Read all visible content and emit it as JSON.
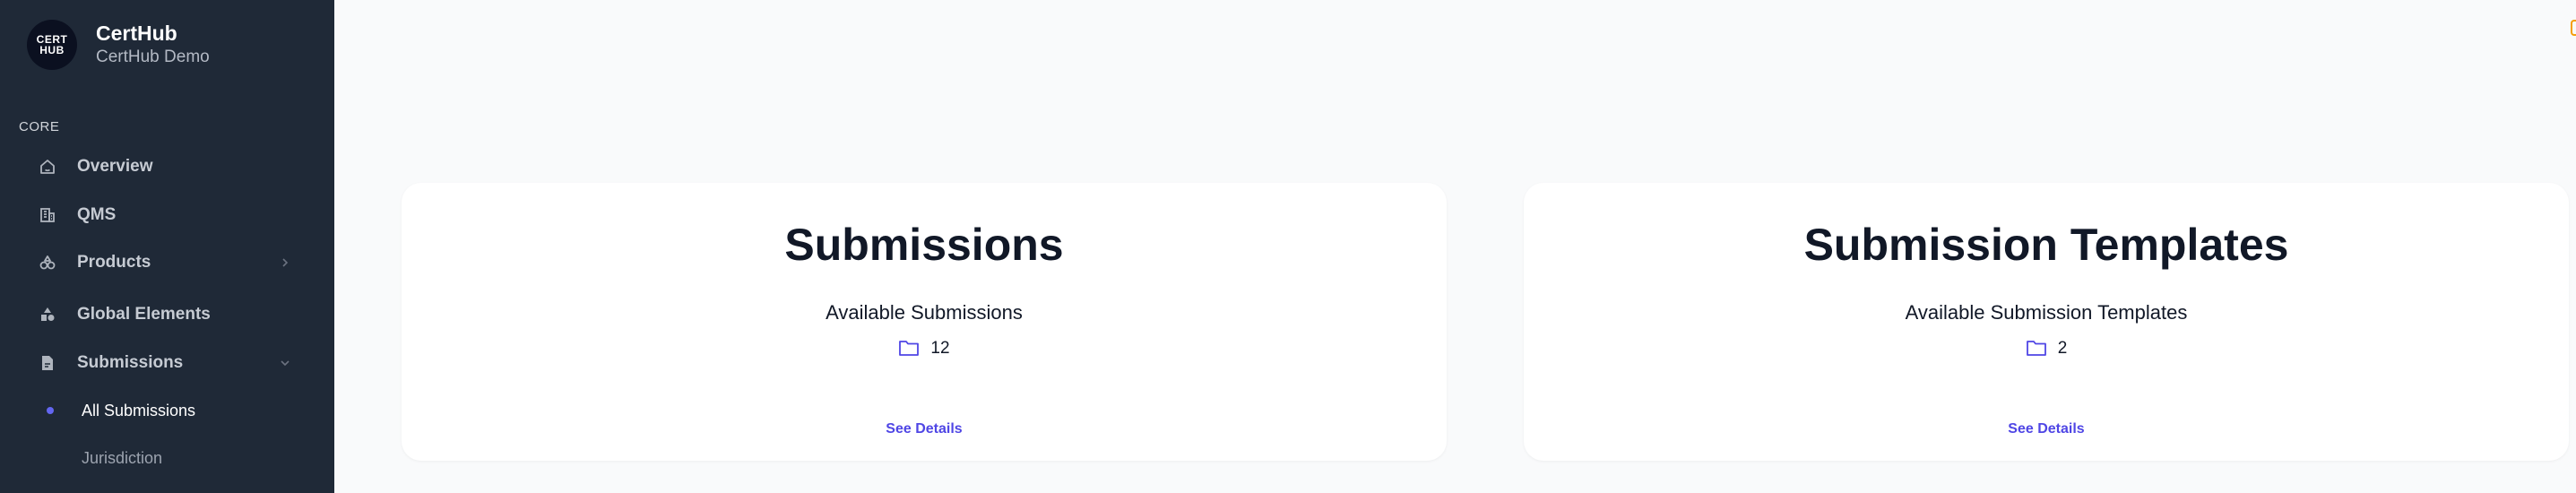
{
  "app": {
    "name": "CertHub",
    "org": "CertHub Demo",
    "logo_line1": "CERT",
    "logo_line2": "HUB"
  },
  "sidebar": {
    "section_label": "CORE",
    "items": [
      {
        "label": "Overview",
        "icon": "home-icon",
        "has_chevron": false
      },
      {
        "label": "QMS",
        "icon": "building-icon",
        "has_chevron": false
      },
      {
        "label": "Products",
        "icon": "shapes-icon",
        "has_chevron": true,
        "chevron": "chevron-right-icon"
      },
      {
        "label": "Global Elements",
        "icon": "triangle-square-icon",
        "has_chevron": false
      },
      {
        "label": "Submissions",
        "icon": "document-icon",
        "has_chevron": true,
        "chevron": "chevron-down-icon"
      }
    ],
    "sub_items": [
      {
        "label": "All Submissions",
        "active": true
      },
      {
        "label": "Jurisdiction",
        "active": false
      }
    ]
  },
  "cards": [
    {
      "title": "Submissions",
      "subtitle": "Available Submissions",
      "count": "12",
      "link": "See Details"
    },
    {
      "title": "Submission Templates",
      "subtitle": "Available Submission Templates",
      "count": "2",
      "link": "See Details"
    }
  ],
  "colors": {
    "sidebar_bg": "#1f2937",
    "accent": "#4f46e5",
    "page_bg": "#f9fafb"
  }
}
